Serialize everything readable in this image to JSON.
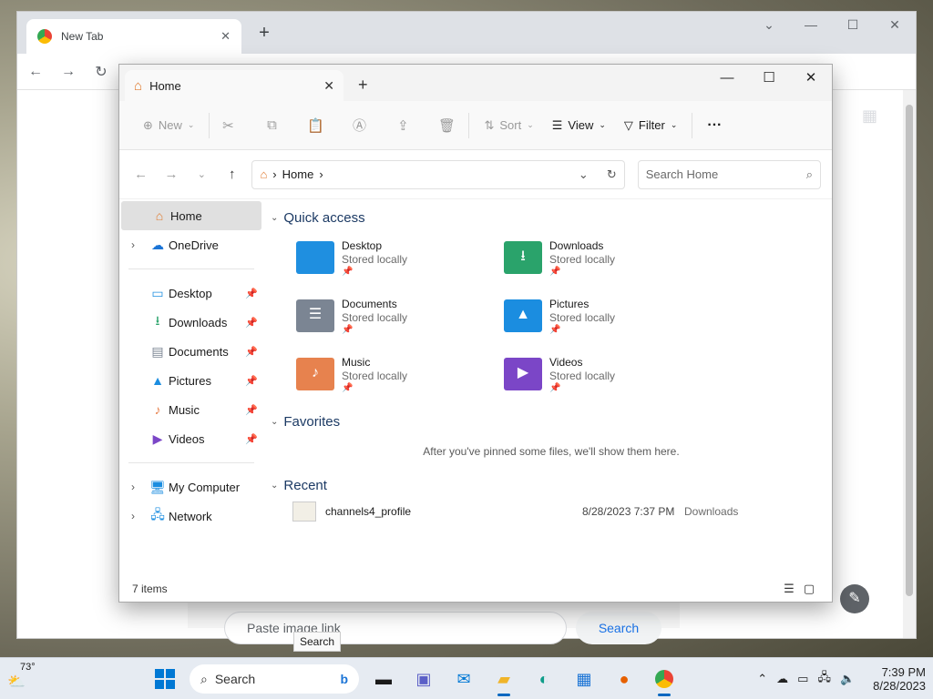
{
  "chrome": {
    "tab_title": "New Tab",
    "paste_placeholder": "Paste image link",
    "search_label": "Search"
  },
  "explorer": {
    "tab_title": "Home",
    "commands": {
      "new": "New",
      "sort": "Sort",
      "view": "View",
      "filter": "Filter",
      "more": "···"
    },
    "address": {
      "crumb": "Home",
      "separator": "›"
    },
    "search_placeholder": "Search Home",
    "nav": {
      "top": [
        {
          "label": "Home",
          "icon": "home-icon",
          "selected": true
        },
        {
          "label": "OneDrive",
          "icon": "cloud-icon",
          "expandable": true
        }
      ],
      "pinned": [
        {
          "label": "Desktop",
          "icon": "desktop-icon"
        },
        {
          "label": "Downloads",
          "icon": "download-icon"
        },
        {
          "label": "Documents",
          "icon": "documents-icon"
        },
        {
          "label": "Pictures",
          "icon": "pictures-icon"
        },
        {
          "label": "Music",
          "icon": "music-icon"
        },
        {
          "label": "Videos",
          "icon": "videos-icon"
        }
      ],
      "bottom": [
        {
          "label": "My Computer",
          "icon": "computer-icon"
        },
        {
          "label": "Network",
          "icon": "network-icon"
        }
      ]
    },
    "sections": {
      "quick_access": "Quick access",
      "favorites": "Favorites",
      "recent": "Recent"
    },
    "quick_access": [
      {
        "name": "Desktop",
        "status": "Stored locally",
        "color": "#1f8fe0",
        "glyph": ""
      },
      {
        "name": "Downloads",
        "status": "Stored locally",
        "color": "#2aa36b",
        "glyph": "⭳"
      },
      {
        "name": "Documents",
        "status": "Stored locally",
        "color": "#7b8593",
        "glyph": "☰"
      },
      {
        "name": "Pictures",
        "status": "Stored locally",
        "color": "#1b8de0",
        "glyph": "▲"
      },
      {
        "name": "Music",
        "status": "Stored locally",
        "color": "#e7824e",
        "glyph": "♪"
      },
      {
        "name": "Videos",
        "status": "Stored locally",
        "color": "#7b46c7",
        "glyph": "▶"
      }
    ],
    "favorites_empty": "After you've pinned some files, we'll show them here.",
    "recent": [
      {
        "name": "channels4_profile",
        "date": "8/28/2023 7:37 PM",
        "location": "Downloads"
      }
    ],
    "status": {
      "item_count": "7 items"
    }
  },
  "tooltip": "Search",
  "taskbar": {
    "weather": "73°",
    "search_label": "Search",
    "time": "7:39 PM",
    "date": "8/28/2023"
  },
  "colors": {
    "accent": "#0067c0",
    "section_text": "#1c3a64"
  }
}
